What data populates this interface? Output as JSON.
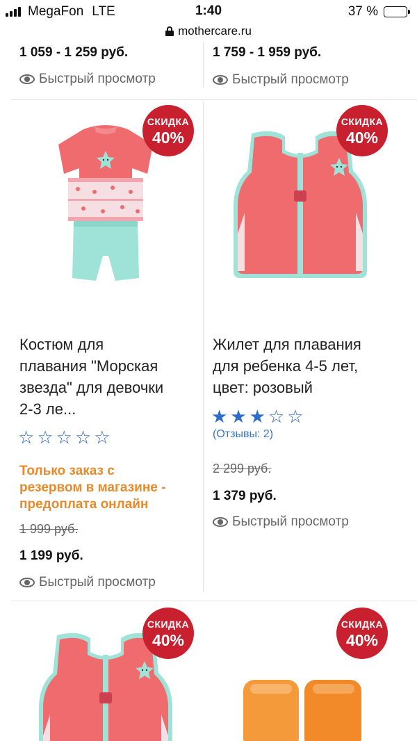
{
  "status_bar": {
    "carrier": "MegaFon",
    "network": "LTE",
    "time": "1:40",
    "battery_text": "37 %",
    "battery_level": 0.37
  },
  "url_bar": {
    "domain": "mothercare.ru"
  },
  "quick_view_label": "Быстрый просмотр",
  "top_row": [
    {
      "price_range": "1 059  - 1 259 руб."
    },
    {
      "price_range": "1 759  - 1 959 руб."
    }
  ],
  "products": [
    {
      "badge_line1": "СКИДКА",
      "badge_line2": "40%",
      "image": "swimsuit-starfish-image",
      "title_lines": [
        "Костюм для",
        "плавания \"Морская",
        "звезда\" для девочки",
        "2-3 ле..."
      ],
      "rating": 0,
      "rating_max": 5,
      "note_lines": [
        "Только заказ с",
        "резервом в магазине -",
        "предоплата онлайн"
      ],
      "old_price": "1 999 руб.",
      "new_price": "1 199 руб."
    },
    {
      "badge_line1": "СКИДКА",
      "badge_line2": "40%",
      "image": "swim-vest-image",
      "title_lines": [
        "Жилет для плавания",
        "для ребенка 4-5 лет,",
        "цвет: розовый"
      ],
      "rating": 3,
      "rating_max": 5,
      "reviews": "(Отзывы: 2)",
      "old_price": "2 299 руб.",
      "new_price": "1 379 руб."
    },
    {
      "badge_line1": "СКИДКА",
      "badge_line2": "40%",
      "image": "swim-vest-image"
    },
    {
      "badge_line1": "СКИДКА",
      "badge_line2": "40%",
      "image": "armbands-image"
    }
  ],
  "colors": {
    "badge": "#c8202f",
    "star": "#2d6cc8",
    "note": "#e98a2a",
    "vest_pink": "#ef6b6e",
    "trim_mint": "#9fe3d8"
  }
}
